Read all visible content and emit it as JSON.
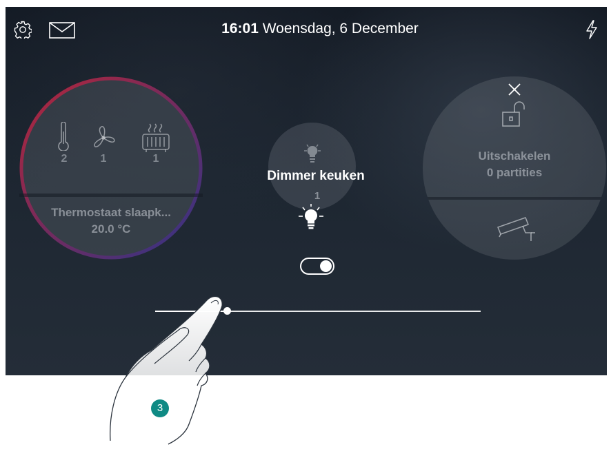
{
  "header": {
    "time": "16:01",
    "date": "Woensdag, 6 December",
    "icons": [
      "gear-icon",
      "mail-icon",
      "lightning-icon"
    ]
  },
  "thermostat": {
    "counts": [
      "2",
      "1",
      "1"
    ],
    "icons": [
      "thermometer-icon",
      "fan-icon",
      "radiator-icon"
    ],
    "name": "Thermostaat slaapk...",
    "temperature": "20.0 °C",
    "colors": {
      "heat": "#b3263a",
      "cool": "#3a3a8c"
    }
  },
  "dimmer": {
    "title": "Dimmer keuken",
    "count": "1",
    "toggle_on": true,
    "level_fraction": 0.22,
    "icons": [
      "bulb-dim-icon",
      "bulb-on-icon"
    ]
  },
  "alarm": {
    "status_line1": "Uitschakelen",
    "status_line2": "0 partities",
    "icons": [
      "close-icon",
      "unlock-icon",
      "camera-icon"
    ]
  },
  "annotation": {
    "step": "3",
    "badge_color": "#0f8a84"
  }
}
